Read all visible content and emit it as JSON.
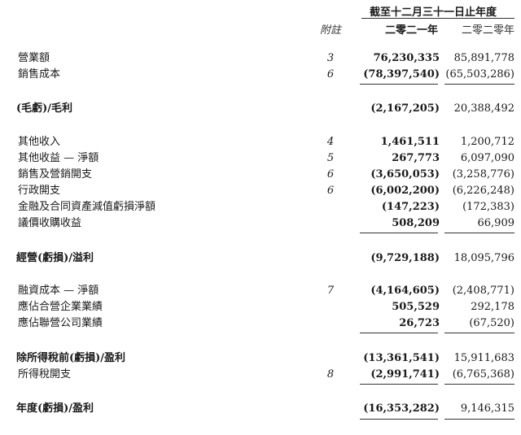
{
  "header": {
    "period": "截至十二月三十一日止年度",
    "note_col": "附註",
    "year_current": "二零二一年",
    "year_prior": "二零二零年"
  },
  "rows": [
    {
      "label": "營業額",
      "note": "3",
      "v2021": "76,230,335",
      "v2020": "85,891,778"
    },
    {
      "label": "銷售成本",
      "note": "6",
      "v2021": "(78,397,540)",
      "v2020": "(65,503,286)"
    },
    {
      "label": "(毛虧)/毛利",
      "note": "",
      "v2021": "(2,167,205)",
      "v2020": "20,388,492"
    },
    {
      "label": "其他收入",
      "note": "4",
      "v2021": "1,461,511",
      "v2020": "1,200,712"
    },
    {
      "label": "其他收益 — 淨額",
      "note": "5",
      "v2021": "267,773",
      "v2020": "6,097,090"
    },
    {
      "label": "銷售及營銷開支",
      "note": "6",
      "v2021": "(3,650,053)",
      "v2020": "(3,258,776)"
    },
    {
      "label": "行政開支",
      "note": "6",
      "v2021": "(6,002,200)",
      "v2020": "(6,226,248)"
    },
    {
      "label": "金融及合同資產減值虧損淨額",
      "note": "",
      "v2021": "(147,223)",
      "v2020": "(172,383)"
    },
    {
      "label": "議價收購收益",
      "note": "",
      "v2021": "508,209",
      "v2020": "66,909"
    },
    {
      "label": "經營(虧損)/溢利",
      "note": "",
      "v2021": "(9,729,188)",
      "v2020": "18,095,796"
    },
    {
      "label": "融資成本 — 淨額",
      "note": "7",
      "v2021": "(4,164,605)",
      "v2020": "(2,408,771)"
    },
    {
      "label": "應佔合營企業業績",
      "note": "",
      "v2021": "505,529",
      "v2020": "292,178"
    },
    {
      "label": "應佔聯營公司業績",
      "note": "",
      "v2021": "26,723",
      "v2020": "(67,520)"
    },
    {
      "label": "除所得稅前(虧損)/盈利",
      "note": "",
      "v2021": "(13,361,541)",
      "v2020": "15,911,683"
    },
    {
      "label": "所得稅開支",
      "note": "8",
      "v2021": "(2,991,741)",
      "v2020": "(6,765,368)"
    },
    {
      "label": "年度(虧損)/盈利",
      "note": "",
      "v2021": "(16,353,282)",
      "v2020": "9,146,315"
    }
  ]
}
